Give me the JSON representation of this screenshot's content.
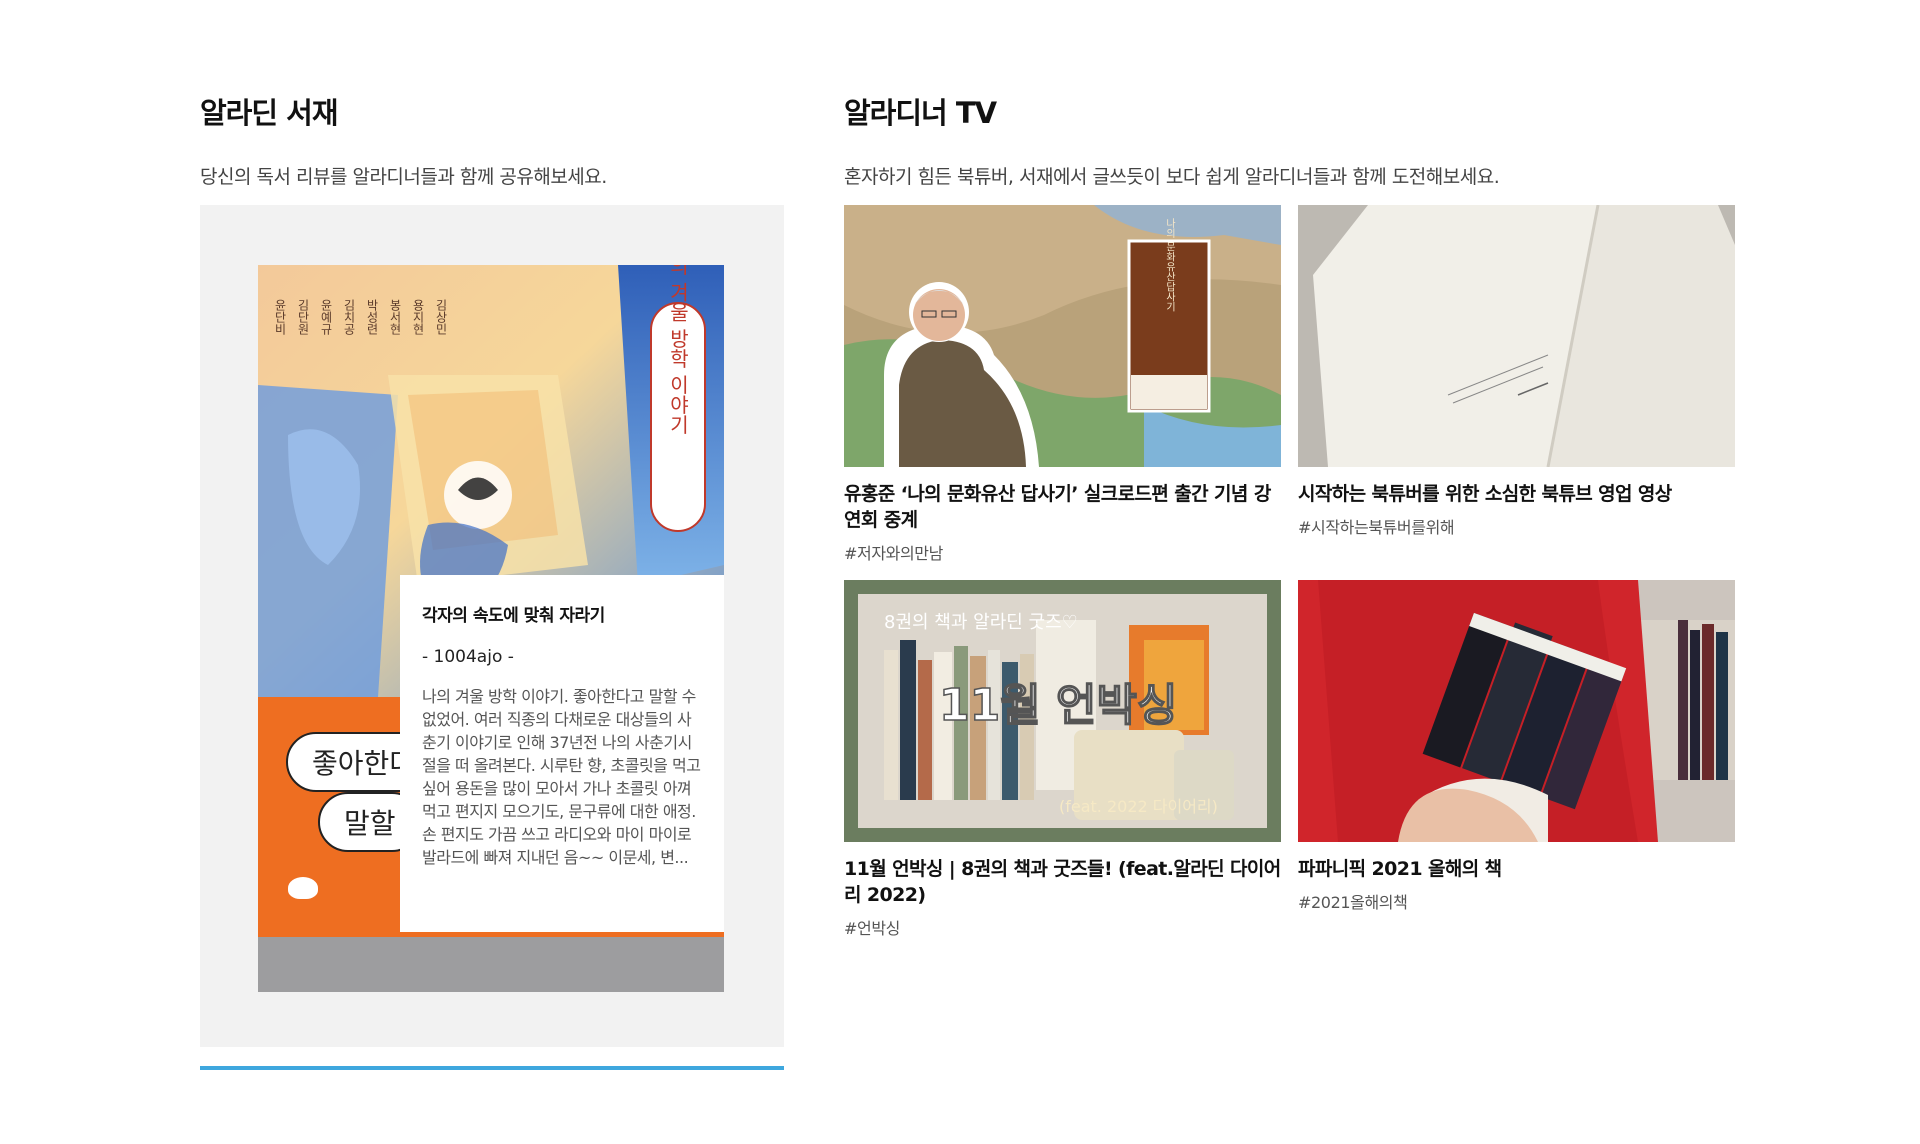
{
  "seojae": {
    "title": "알라딘 서재",
    "description": "당신의 독서 리뷰를 알라디너들과 함께 공유해보세요.",
    "book": {
      "vertical_title": "나의 겨울 방학 이야기",
      "authors": [
        "김상민",
        "용지현",
        "봉서현",
        "박성련",
        "김치공",
        "윤예규",
        "김단원",
        "윤단비"
      ],
      "cloud_line1": "좋아한다",
      "cloud_line2": "말할"
    },
    "review": {
      "title": "각자의 속도에 맞춰 자라기",
      "author": "- 1004ajo -",
      "body": "나의 겨울 방학 이야기. 좋아한다고 말할 수 없었어. 여러 직종의 다채로운 대상들의 사춘기 이야기로 인해 37년전 나의 사춘기시절을 떠 올려본다. 시루탄 향, 초콜릿을 먹고 싶어 용돈을 많이 모아서 가나 초콜릿 아껴먹고 편지지 모으기도, 문구류에 대한 애정. 손 편지도 가끔 쓰고 라디오와 마이 마이로 발라드에 빠져 지내던 음~~ 이문세, 변..."
    },
    "carousel_progress": 1.0
  },
  "tv": {
    "title": "알라디너 TV",
    "description": "혼자하기 힘든 북튜버, 서재에서 글쓰듯이 보다 쉽게 알라디너들과 함께 도전해보세요.",
    "videos": [
      {
        "title": "유홍준 ‘나의 문화유산 답사기’ 실크로드편 출간 기념 강연회 중계",
        "tag": "#저자와의만남",
        "thumb_text": "나의 문화유산답사기"
      },
      {
        "title": "시작하는 북튜버를 위한 소심한 북튜브 영업 영상",
        "tag": "#시작하는북튜버를위해",
        "thumb_text": ""
      },
      {
        "title": "11월 언박싱 | 8권의 책과 굿즈들! (feat.알라딘 다이어리 2022)",
        "tag": "#언박싱",
        "thumb_text": "8권의 책과 알라딘 굿즈♡",
        "thumb_text2": "11월 언박싱",
        "thumb_text3": "(feat. 2022 다이어리)"
      },
      {
        "title": "파파니픽 2021 올해의 책",
        "tag": "#2021올해의책",
        "thumb_text": ""
      }
    ]
  },
  "colors": {
    "accent": "#3ea7de",
    "book_orange": "#ee6e21",
    "panel_bg": "#f2f2f2"
  }
}
